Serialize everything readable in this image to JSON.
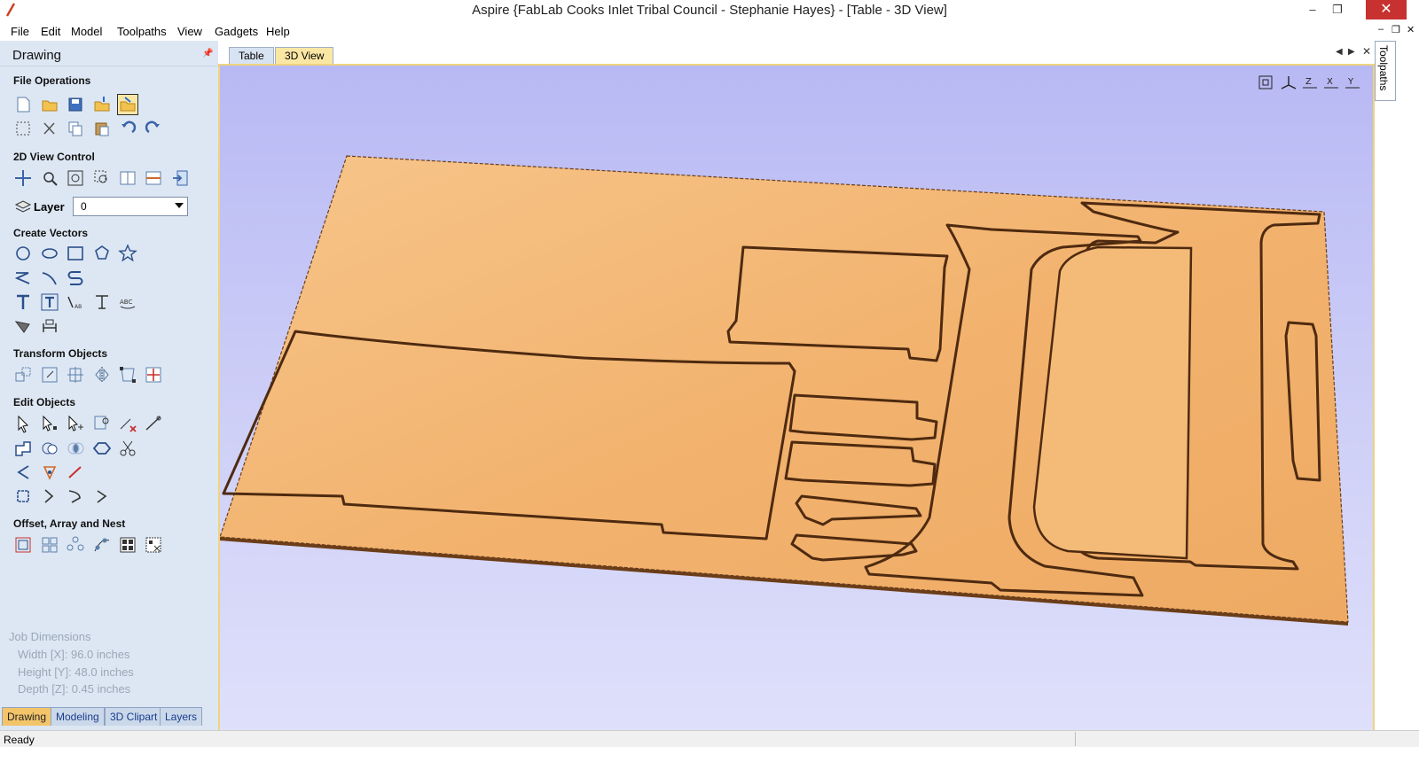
{
  "window": {
    "title": "Aspire {FabLab Cooks Inlet Tribal Council - Stephanie Hayes} - [Table - 3D View]",
    "minimize": "–",
    "maximize": "❐",
    "close": "✕"
  },
  "menu": [
    "File",
    "Edit",
    "Model",
    "Toolpaths",
    "View",
    "Gadgets",
    "Help"
  ],
  "mdi_controls": [
    "–",
    "❐",
    "✕"
  ],
  "panel": {
    "title": "Drawing",
    "sections": {
      "file_operations": "File Operations",
      "view_control": "2D View Control",
      "create_vectors": "Create Vectors",
      "transform_objects": "Transform Objects",
      "edit_objects": "Edit Objects",
      "offset_array_nest": "Offset, Array and Nest"
    },
    "layer": {
      "label": "Layer",
      "value": "0"
    },
    "job_dimensions": {
      "title": "Job Dimensions",
      "width": "Width  [X]: 96.0 inches",
      "height": "Height [Y]: 48.0 inches",
      "depth": "Depth  [Z]: 0.45 inches"
    },
    "bottom_tabs": [
      "Drawing",
      "Modeling",
      "3D Clipart",
      "Layers"
    ]
  },
  "doc_tabs": [
    "Table",
    "3D View"
  ],
  "view_buttons": [
    "fit-view-icon",
    "iso-view-icon",
    "z-view-icon",
    "x-view-icon",
    "y-view-icon"
  ],
  "side_tab": "Toolpaths",
  "status": "Ready",
  "colors": {
    "wood": "#f2b36f",
    "cut": "#5a3214",
    "panel_bg": "#dde7f3",
    "view_bg": "#b8b9f4"
  }
}
